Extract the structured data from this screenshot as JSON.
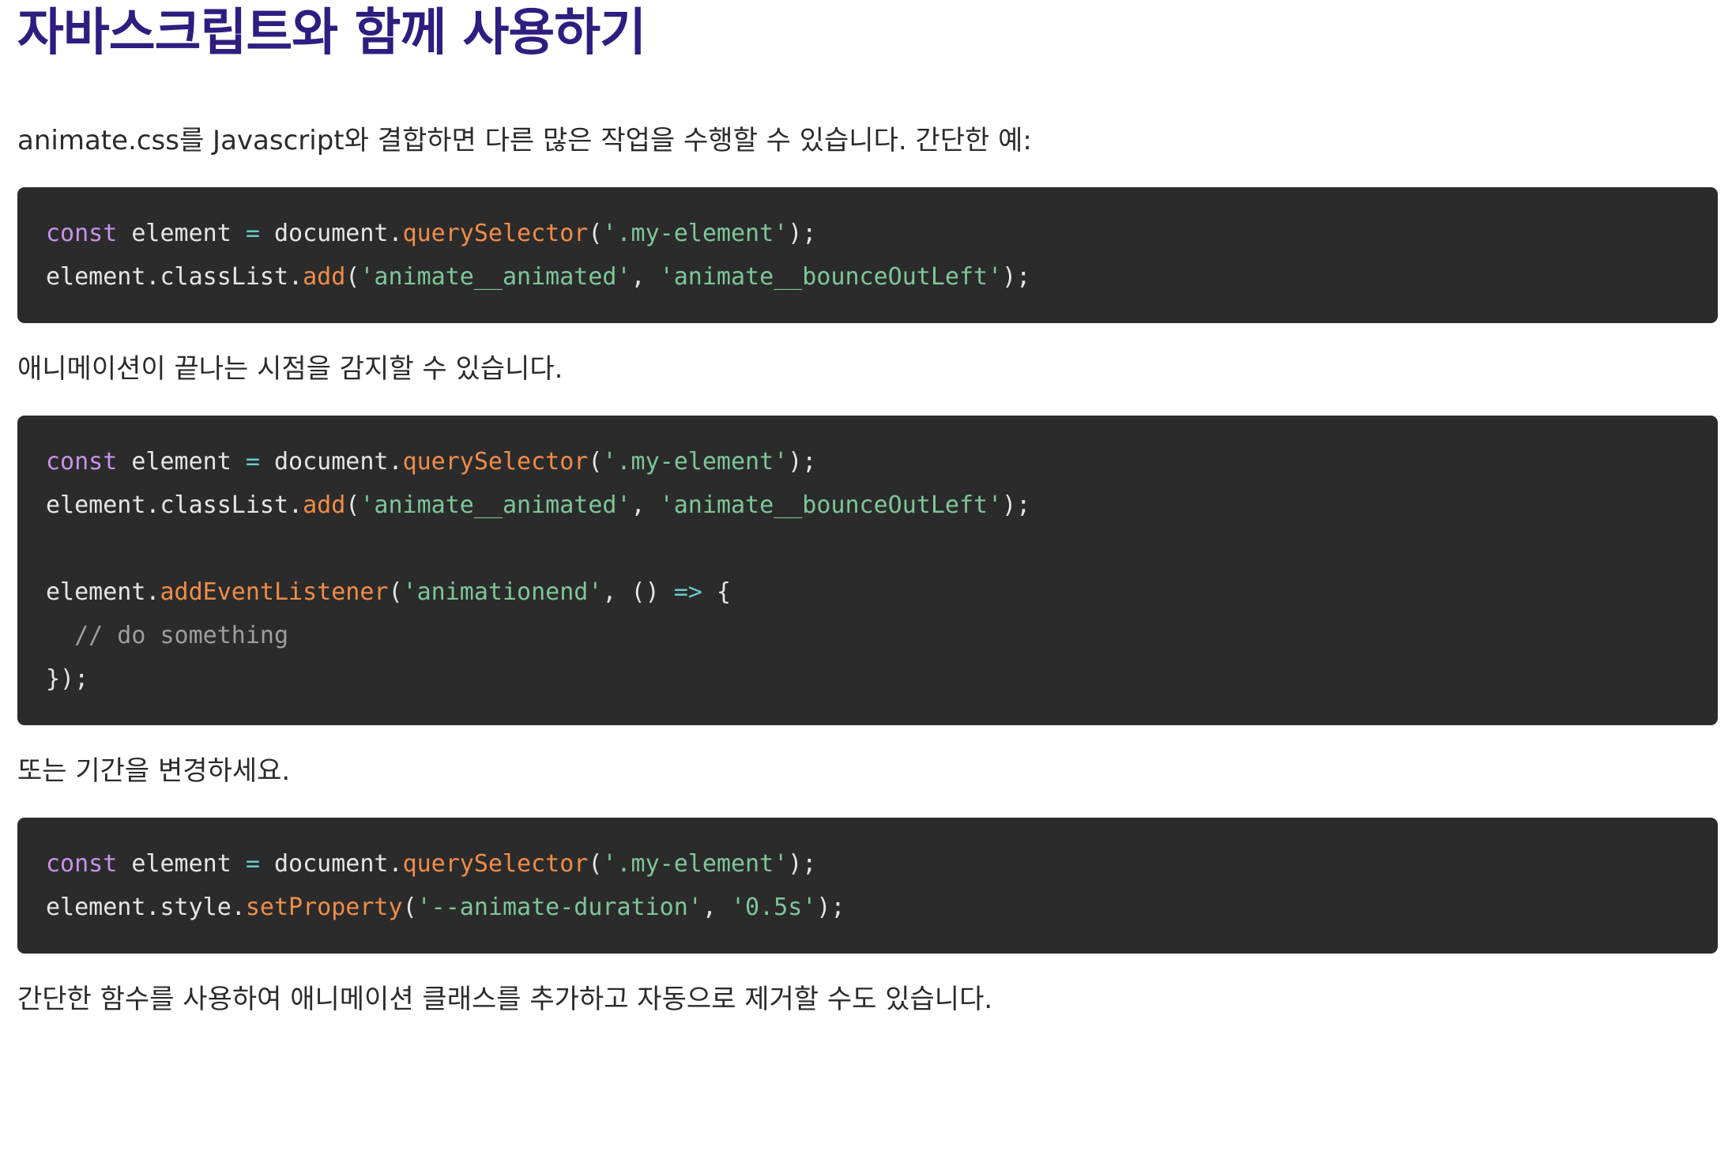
{
  "heading": "자바스크립트와 함께 사용하기",
  "paragraphs": {
    "intro": "animate.css를 Javascript와 결합하면 다른 많은 작업을 수행할 수 있습니다. 간단한 예:",
    "detect_end": "애니메이션이 끝나는 시점을 감지할 수 있습니다.",
    "change_duration": "또는 기간을 변경하세요.",
    "helper_function": "간단한 함수를 사용하여 애니메이션 클래스를 추가하고 자동으로 제거할 수도 있습니다."
  },
  "code_blocks": [
    {
      "lines": [
        [
          {
            "t": "const",
            "k": "kw"
          },
          {
            "t": " element ",
            "k": "pl"
          },
          {
            "t": "=",
            "k": "op"
          },
          {
            "t": " document.",
            "k": "pl"
          },
          {
            "t": "querySelector",
            "k": "fn"
          },
          {
            "t": "(",
            "k": "pl"
          },
          {
            "t": "'.my-element'",
            "k": "str"
          },
          {
            "t": ");",
            "k": "pl"
          }
        ],
        [
          {
            "t": "element.classList.",
            "k": "pl"
          },
          {
            "t": "add",
            "k": "fn"
          },
          {
            "t": "(",
            "k": "pl"
          },
          {
            "t": "'animate__animated'",
            "k": "str"
          },
          {
            "t": ", ",
            "k": "pl"
          },
          {
            "t": "'animate__bounceOutLeft'",
            "k": "str"
          },
          {
            "t": ");",
            "k": "pl"
          }
        ]
      ]
    },
    {
      "lines": [
        [
          {
            "t": "const",
            "k": "kw"
          },
          {
            "t": " element ",
            "k": "pl"
          },
          {
            "t": "=",
            "k": "op"
          },
          {
            "t": " document.",
            "k": "pl"
          },
          {
            "t": "querySelector",
            "k": "fn"
          },
          {
            "t": "(",
            "k": "pl"
          },
          {
            "t": "'.my-element'",
            "k": "str"
          },
          {
            "t": ");",
            "k": "pl"
          }
        ],
        [
          {
            "t": "element.classList.",
            "k": "pl"
          },
          {
            "t": "add",
            "k": "fn"
          },
          {
            "t": "(",
            "k": "pl"
          },
          {
            "t": "'animate__animated'",
            "k": "str"
          },
          {
            "t": ", ",
            "k": "pl"
          },
          {
            "t": "'animate__bounceOutLeft'",
            "k": "str"
          },
          {
            "t": ");",
            "k": "pl"
          }
        ],
        [],
        [
          {
            "t": "element.",
            "k": "pl"
          },
          {
            "t": "addEventListener",
            "k": "fn"
          },
          {
            "t": "(",
            "k": "pl"
          },
          {
            "t": "'animationend'",
            "k": "str"
          },
          {
            "t": ", () ",
            "k": "pl"
          },
          {
            "t": "=>",
            "k": "op"
          },
          {
            "t": " {",
            "k": "pl"
          }
        ],
        [
          {
            "t": "  // do something",
            "k": "cm"
          }
        ],
        [
          {
            "t": "});",
            "k": "pl"
          }
        ]
      ]
    },
    {
      "lines": [
        [
          {
            "t": "const",
            "k": "kw"
          },
          {
            "t": " element ",
            "k": "pl"
          },
          {
            "t": "=",
            "k": "op"
          },
          {
            "t": " document.",
            "k": "pl"
          },
          {
            "t": "querySelector",
            "k": "fn"
          },
          {
            "t": "(",
            "k": "pl"
          },
          {
            "t": "'.my-element'",
            "k": "str"
          },
          {
            "t": ");",
            "k": "pl"
          }
        ],
        [
          {
            "t": "element.style.",
            "k": "pl"
          },
          {
            "t": "setProperty",
            "k": "fn"
          },
          {
            "t": "(",
            "k": "pl"
          },
          {
            "t": "'--animate-duration'",
            "k": "str"
          },
          {
            "t": ", ",
            "k": "pl"
          },
          {
            "t": "'0.5s'",
            "k": "str"
          },
          {
            "t": ");",
            "k": "pl"
          }
        ]
      ]
    }
  ],
  "colors": {
    "heading": "#2f1d80",
    "code_background": "#2b2b2b",
    "keyword": "#c792ea",
    "function": "#f08d49",
    "string": "#7ec699",
    "operator": "#67cdcc",
    "plain": "#e6e6e6",
    "comment": "#9e9e9e"
  }
}
